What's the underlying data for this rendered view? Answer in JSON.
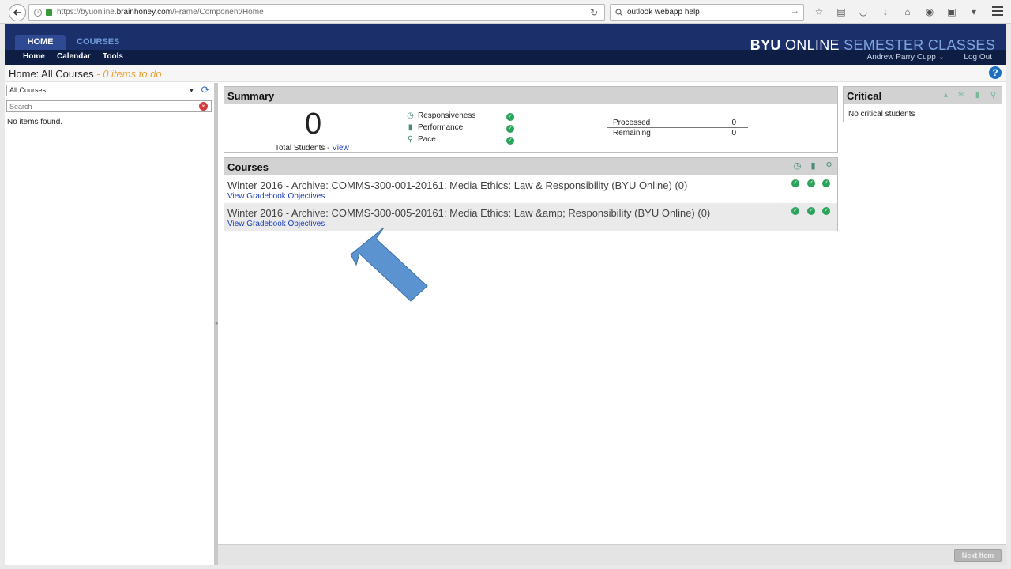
{
  "browser": {
    "url_prefix": "https://byuonline.",
    "url_host": "brainhoney.com",
    "url_path": "/Frame/Component/Home",
    "search_value": "outlook webapp help"
  },
  "header": {
    "tabs": [
      "HOME",
      "COURSES"
    ],
    "brand_bold": "BYU",
    "brand_mid": "ONLINE",
    "brand_end": "SEMESTER CLASSES",
    "subnav": [
      "Home",
      "Calendar",
      "Tools"
    ],
    "user": "Andrew Parry Cupp",
    "logout": "Log Out"
  },
  "title": {
    "main": "Home: All Courses",
    "separator": " - ",
    "todo": "0 items to do"
  },
  "left": {
    "select_value": "All Courses",
    "search_placeholder": "Search",
    "empty_text": "No items found."
  },
  "summary": {
    "heading": "Summary",
    "total": "0",
    "total_label": "Total Students - ",
    "view_link": "View",
    "metrics": [
      "Responsiveness",
      "Performance",
      "Pace"
    ],
    "processed_label": "Processed",
    "processed_value": "0",
    "remaining_label": "Remaining",
    "remaining_value": "0"
  },
  "courses": {
    "heading": "Courses",
    "rows": [
      {
        "title": "Winter 2016 - Archive: COMMS-300-001-20161: Media Ethics: Law & Responsibility (BYU Online) (0)",
        "link": "View Gradebook Objectives"
      },
      {
        "title": "Winter 2016 - Archive: COMMS-300-005-20161: Media Ethics: Law &amp; Responsibility (BYU Online) (0)",
        "link": "View Gradebook Objectives"
      }
    ]
  },
  "critical": {
    "heading": "Critical",
    "empty_text": "No critical students"
  },
  "footer": {
    "next_button": "Next Item"
  },
  "colors": {
    "header_navy": "#1b2f6a",
    "accent_orange": "#e8a33a",
    "check_green": "#2aa45a",
    "arrow_blue": "#5b93d0"
  }
}
